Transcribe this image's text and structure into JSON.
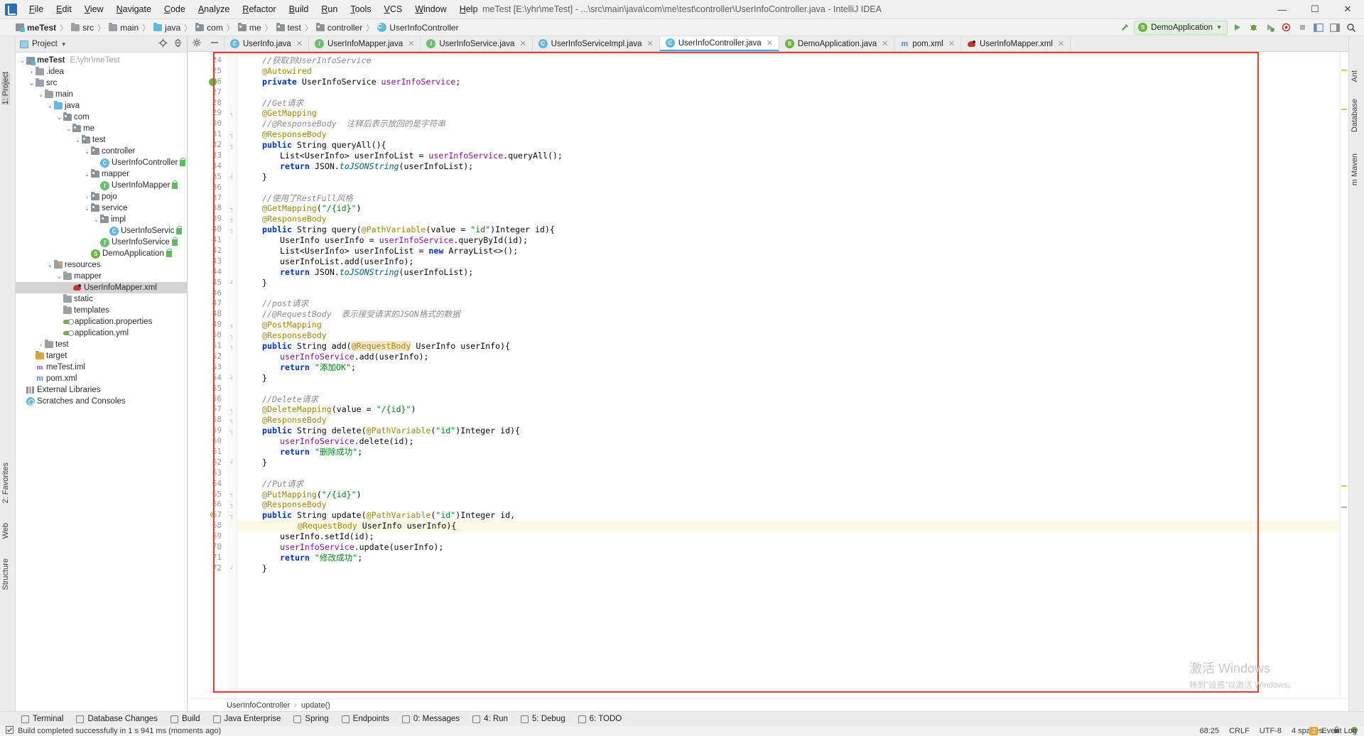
{
  "window": {
    "title": "meTest [E:\\yhr\\meTest] - ...\\src\\main\\java\\com\\me\\test\\controller\\UserInfoController.java - IntelliJ IDEA",
    "minimize": "—",
    "maximize": "☐",
    "close": "✕"
  },
  "menu": [
    "File",
    "Edit",
    "View",
    "Navigate",
    "Code",
    "Analyze",
    "Refactor",
    "Build",
    "Run",
    "Tools",
    "VCS",
    "Window",
    "Help"
  ],
  "navbar": {
    "crumbs": [
      "meTest",
      "src",
      "main",
      "java",
      "com",
      "me",
      "test",
      "controller",
      "UserInfoController"
    ],
    "run_config": "DemoApplication",
    "icons": [
      "hammer-build-icon",
      "run-icon",
      "debug-icon",
      "run-coverage-icon",
      "profiler-icon",
      "stop-icon",
      "search-everywhere-icon"
    ]
  },
  "project_panel": {
    "title": "Project",
    "tree": [
      {
        "depth": 0,
        "arrow": "⌄",
        "icon": "project",
        "label": "meTest",
        "path": "E:\\yhr\\meTest",
        "bold": true
      },
      {
        "depth": 1,
        "arrow": "›",
        "icon": "folder",
        "label": ".idea"
      },
      {
        "depth": 1,
        "arrow": "⌄",
        "icon": "folder",
        "label": "src"
      },
      {
        "depth": 2,
        "arrow": "⌄",
        "icon": "folder",
        "label": "main"
      },
      {
        "depth": 3,
        "arrow": "⌄",
        "icon": "folder-blue",
        "label": "java"
      },
      {
        "depth": 4,
        "arrow": "⌄",
        "icon": "package",
        "label": "com"
      },
      {
        "depth": 5,
        "arrow": "⌄",
        "icon": "package",
        "label": "me"
      },
      {
        "depth": 6,
        "arrow": "⌄",
        "icon": "package",
        "label": "test"
      },
      {
        "depth": 7,
        "arrow": "⌄",
        "icon": "package",
        "label": "controller"
      },
      {
        "depth": 8,
        "arrow": "",
        "icon": "class",
        "label": "UserInfoController",
        "lock": true
      },
      {
        "depth": 7,
        "arrow": "⌄",
        "icon": "package",
        "label": "mapper"
      },
      {
        "depth": 8,
        "arrow": "",
        "icon": "interface",
        "label": "UserInfoMapper",
        "lock": true
      },
      {
        "depth": 7,
        "arrow": "›",
        "icon": "package",
        "label": "pojo"
      },
      {
        "depth": 7,
        "arrow": "⌄",
        "icon": "package",
        "label": "service"
      },
      {
        "depth": 8,
        "arrow": "⌄",
        "icon": "package",
        "label": "impl"
      },
      {
        "depth": 9,
        "arrow": "",
        "icon": "class",
        "label": "UserInfoServic",
        "lock": true
      },
      {
        "depth": 8,
        "arrow": "",
        "icon": "interface",
        "label": "UserInfoService",
        "lock": true
      },
      {
        "depth": 7,
        "arrow": "",
        "icon": "spring",
        "label": "DemoApplication",
        "lock": true
      },
      {
        "depth": 3,
        "arrow": "⌄",
        "icon": "resources",
        "label": "resources"
      },
      {
        "depth": 4,
        "arrow": "⌄",
        "icon": "folder",
        "label": "mapper"
      },
      {
        "depth": 5,
        "arrow": "",
        "icon": "xml",
        "label": "UserInfoMapper.xml",
        "selected": true
      },
      {
        "depth": 4,
        "arrow": "",
        "icon": "folder",
        "label": "static"
      },
      {
        "depth": 4,
        "arrow": "",
        "icon": "folder",
        "label": "templates"
      },
      {
        "depth": 4,
        "arrow": "",
        "icon": "properties",
        "label": "application.properties"
      },
      {
        "depth": 4,
        "arrow": "",
        "icon": "properties",
        "label": "application.yml"
      },
      {
        "depth": 2,
        "arrow": "›",
        "icon": "folder",
        "label": "test"
      },
      {
        "depth": 1,
        "arrow": "",
        "icon": "folder-target",
        "label": "target"
      },
      {
        "depth": 1,
        "arrow": "",
        "icon": "iml",
        "label": "meTest.iml"
      },
      {
        "depth": 1,
        "arrow": "",
        "icon": "maven",
        "label": "pom.xml"
      },
      {
        "depth": 0,
        "arrow": "",
        "icon": "library",
        "label": "External Libraries"
      },
      {
        "depth": 0,
        "arrow": "",
        "icon": "scratch",
        "label": "Scratches and Consoles"
      }
    ]
  },
  "left_strip": [
    "1: Project",
    "2: Favorites",
    "Web",
    "Structure"
  ],
  "right_strip": [
    "Ant",
    "Database",
    "m Maven"
  ],
  "editor_tabs": [
    {
      "label": "UserInfo.java",
      "icon": "class",
      "active": false
    },
    {
      "label": "UserInfoMapper.java",
      "icon": "interface",
      "active": false
    },
    {
      "label": "UserInfoService.java",
      "icon": "interface",
      "active": false
    },
    {
      "label": "UserInfoServiceImpl.java",
      "icon": "class",
      "active": false
    },
    {
      "label": "UserInfoController.java",
      "icon": "class",
      "active": true
    },
    {
      "label": "DemoApplication.java",
      "icon": "spring",
      "active": false
    },
    {
      "label": "pom.xml",
      "icon": "maven",
      "active": false
    },
    {
      "label": "UserInfoMapper.xml",
      "icon": "xml",
      "active": false
    }
  ],
  "code": {
    "first_line": 24,
    "lines": [
      {
        "n": 24,
        "indent": 1,
        "spans": [
          {
            "t": "//获取到UserInfoService",
            "c": "cm"
          }
        ]
      },
      {
        "n": 25,
        "indent": 1,
        "spans": [
          {
            "t": "@Autowired",
            "c": "ann"
          }
        ]
      },
      {
        "n": 26,
        "indent": 1,
        "gutter_icon": "spring-bean-icon",
        "spans": [
          {
            "t": "private ",
            "c": "kw"
          },
          {
            "t": "UserInfoService ",
            "c": "pl"
          },
          {
            "t": "userInfoService",
            "c": "fld"
          },
          {
            "t": ";",
            "c": "pl"
          }
        ]
      },
      {
        "n": 27,
        "indent": 0,
        "spans": []
      },
      {
        "n": 28,
        "indent": 1,
        "spans": [
          {
            "t": "//Get请求",
            "c": "cm"
          }
        ]
      },
      {
        "n": 29,
        "indent": 1,
        "fold": "┐",
        "spans": [
          {
            "t": "@GetMapping",
            "c": "ann"
          }
        ]
      },
      {
        "n": 30,
        "indent": 1,
        "spans": [
          {
            "t": "//@ResponseBody  注释后表示放回的是字符串",
            "c": "cm"
          }
        ]
      },
      {
        "n": 31,
        "indent": 1,
        "fold": "┐",
        "spans": [
          {
            "t": "@ResponseBody",
            "c": "ann"
          }
        ]
      },
      {
        "n": 32,
        "indent": 1,
        "fold": "┐",
        "spans": [
          {
            "t": "public ",
            "c": "kw"
          },
          {
            "t": "String ",
            "c": "pl"
          },
          {
            "t": "queryAll",
            "c": "pl"
          },
          {
            "t": "(){",
            "c": "pl"
          }
        ]
      },
      {
        "n": 33,
        "indent": 2,
        "spans": [
          {
            "t": "List<UserInfo> userInfoList = ",
            "c": "pl"
          },
          {
            "t": "userInfoService",
            "c": "fld"
          },
          {
            "t": ".",
            "c": "pl"
          },
          {
            "t": "queryAll",
            "c": "pl"
          },
          {
            "t": "();",
            "c": "pl"
          }
        ]
      },
      {
        "n": 34,
        "indent": 2,
        "spans": [
          {
            "t": "return ",
            "c": "kw"
          },
          {
            "t": "JSON.",
            "c": "pl"
          },
          {
            "t": "toJSONString",
            "c": "mth"
          },
          {
            "t": "(userInfoList);",
            "c": "pl"
          }
        ]
      },
      {
        "n": 35,
        "indent": 1,
        "fold": "┘",
        "spans": [
          {
            "t": "}",
            "c": "pl"
          }
        ]
      },
      {
        "n": 36,
        "indent": 0,
        "spans": []
      },
      {
        "n": 37,
        "indent": 1,
        "spans": [
          {
            "t": "//使用了RestFull风格",
            "c": "cm"
          }
        ]
      },
      {
        "n": 38,
        "indent": 1,
        "fold": "┐",
        "spans": [
          {
            "t": "@GetMapping",
            "c": "ann"
          },
          {
            "t": "(",
            "c": "pl"
          },
          {
            "t": "\"/{id}\"",
            "c": "str"
          },
          {
            "t": ")",
            "c": "pl"
          }
        ]
      },
      {
        "n": 39,
        "indent": 1,
        "fold": "┐",
        "spans": [
          {
            "t": "@ResponseBody",
            "c": "ann"
          }
        ]
      },
      {
        "n": 40,
        "indent": 1,
        "fold": "┐",
        "spans": [
          {
            "t": "public ",
            "c": "kw"
          },
          {
            "t": "String query(",
            "c": "pl"
          },
          {
            "t": "@PathVariable",
            "c": "ann"
          },
          {
            "t": "(value = ",
            "c": "pl"
          },
          {
            "t": "\"id\"",
            "c": "str"
          },
          {
            "t": ")Integer id){",
            "c": "pl"
          }
        ]
      },
      {
        "n": 41,
        "indent": 2,
        "spans": [
          {
            "t": "UserInfo userInfo = ",
            "c": "pl"
          },
          {
            "t": "userInfoService",
            "c": "fld"
          },
          {
            "t": ".",
            "c": "pl"
          },
          {
            "t": "queryById",
            "c": "pl"
          },
          {
            "t": "(id);",
            "c": "pl"
          }
        ]
      },
      {
        "n": 42,
        "indent": 2,
        "spans": [
          {
            "t": "List<UserInfo> userInfoList = ",
            "c": "pl"
          },
          {
            "t": "new ",
            "c": "kw"
          },
          {
            "t": "ArrayList<>();",
            "c": "pl"
          }
        ]
      },
      {
        "n": 43,
        "indent": 2,
        "spans": [
          {
            "t": "userInfoList.add(userInfo);",
            "c": "pl"
          }
        ]
      },
      {
        "n": 44,
        "indent": 2,
        "spans": [
          {
            "t": "return ",
            "c": "kw"
          },
          {
            "t": "JSON.",
            "c": "pl"
          },
          {
            "t": "toJSONString",
            "c": "mth"
          },
          {
            "t": "(userInfoList);",
            "c": "pl"
          }
        ]
      },
      {
        "n": 45,
        "indent": 1,
        "fold": "┘",
        "spans": [
          {
            "t": "}",
            "c": "pl"
          }
        ]
      },
      {
        "n": 46,
        "indent": 0,
        "spans": []
      },
      {
        "n": 47,
        "indent": 1,
        "spans": [
          {
            "t": "//post请求",
            "c": "cm"
          }
        ]
      },
      {
        "n": 48,
        "indent": 1,
        "spans": [
          {
            "t": "//@RequestBody  表示接受请求的JSON格式的数据",
            "c": "cm"
          }
        ]
      },
      {
        "n": 49,
        "indent": 1,
        "fold": "┐",
        "spans": [
          {
            "t": "@PostMapping",
            "c": "ann"
          }
        ]
      },
      {
        "n": 50,
        "indent": 1,
        "fold": "┐",
        "spans": [
          {
            "t": "@ResponseBody",
            "c": "ann"
          }
        ]
      },
      {
        "n": 51,
        "indent": 1,
        "fold": "┐",
        "spans": [
          {
            "t": "public ",
            "c": "kw"
          },
          {
            "t": "String add(",
            "c": "pl"
          },
          {
            "t": "@RequestBody",
            "c": "ann",
            "hl": true
          },
          {
            "t": " UserInfo userInfo){",
            "c": "pl"
          }
        ]
      },
      {
        "n": 52,
        "indent": 2,
        "spans": [
          {
            "t": "userInfoService",
            "c": "fld"
          },
          {
            "t": ".add(userInfo);",
            "c": "pl"
          }
        ]
      },
      {
        "n": 53,
        "indent": 2,
        "spans": [
          {
            "t": "return ",
            "c": "kw"
          },
          {
            "t": "\"添加OK\"",
            "c": "str"
          },
          {
            "t": ";",
            "c": "pl"
          }
        ]
      },
      {
        "n": 54,
        "indent": 1,
        "fold": "┘",
        "spans": [
          {
            "t": "}",
            "c": "pl"
          }
        ]
      },
      {
        "n": 55,
        "indent": 0,
        "spans": []
      },
      {
        "n": 56,
        "indent": 1,
        "spans": [
          {
            "t": "//Delete请求",
            "c": "cm"
          }
        ]
      },
      {
        "n": 57,
        "indent": 1,
        "fold": "┐",
        "spans": [
          {
            "t": "@DeleteMapping",
            "c": "ann"
          },
          {
            "t": "(value = ",
            "c": "pl"
          },
          {
            "t": "\"/{id}\"",
            "c": "str"
          },
          {
            "t": ")",
            "c": "pl"
          }
        ]
      },
      {
        "n": 58,
        "indent": 1,
        "fold": "┐",
        "spans": [
          {
            "t": "@ResponseBody",
            "c": "ann"
          }
        ]
      },
      {
        "n": 59,
        "indent": 1,
        "fold": "┐",
        "spans": [
          {
            "t": "public ",
            "c": "kw"
          },
          {
            "t": "String delete(",
            "c": "pl"
          },
          {
            "t": "@PathVariable",
            "c": "ann"
          },
          {
            "t": "(",
            "c": "pl"
          },
          {
            "t": "\"id\"",
            "c": "str"
          },
          {
            "t": ")Integer id){",
            "c": "pl"
          }
        ]
      },
      {
        "n": 60,
        "indent": 2,
        "spans": [
          {
            "t": "userInfoService",
            "c": "fld"
          },
          {
            "t": ".delete(id);",
            "c": "pl"
          }
        ]
      },
      {
        "n": 61,
        "indent": 2,
        "spans": [
          {
            "t": "return ",
            "c": "kw"
          },
          {
            "t": "\"删除成功\"",
            "c": "str"
          },
          {
            "t": ";",
            "c": "pl"
          }
        ]
      },
      {
        "n": 62,
        "indent": 1,
        "fold": "┘",
        "spans": [
          {
            "t": "}",
            "c": "pl"
          }
        ]
      },
      {
        "n": 63,
        "indent": 0,
        "spans": []
      },
      {
        "n": 64,
        "indent": 1,
        "spans": [
          {
            "t": "//Put请求",
            "c": "cm"
          }
        ]
      },
      {
        "n": 65,
        "indent": 1,
        "fold": "┐",
        "spans": [
          {
            "t": "@PutMapping",
            "c": "ann"
          },
          {
            "t": "(",
            "c": "pl"
          },
          {
            "t": "\"/{id}\"",
            "c": "str"
          },
          {
            "t": ")",
            "c": "pl"
          }
        ]
      },
      {
        "n": 66,
        "indent": 1,
        "fold": "┐",
        "spans": [
          {
            "t": "@ResponseBody",
            "c": "ann"
          }
        ]
      },
      {
        "n": 67,
        "indent": 1,
        "fold": "┐",
        "marker": "@",
        "spans": [
          {
            "t": "public ",
            "c": "kw"
          },
          {
            "t": "String update(",
            "c": "pl"
          },
          {
            "t": "@PathVariable",
            "c": "ann"
          },
          {
            "t": "(",
            "c": "pl"
          },
          {
            "t": "\"id\"",
            "c": "str"
          },
          {
            "t": ")Integer id,",
            "c": "pl"
          }
        ]
      },
      {
        "n": 68,
        "indent": 3,
        "hl": true,
        "spans": [
          {
            "t": "@RequestBody",
            "c": "ann"
          },
          {
            "t": " UserInfo userInfo){",
            "c": "pl"
          }
        ]
      },
      {
        "n": 69,
        "indent": 2,
        "spans": [
          {
            "t": "userInfo.setId(id);",
            "c": "pl"
          }
        ]
      },
      {
        "n": 70,
        "indent": 2,
        "spans": [
          {
            "t": "userInfoService",
            "c": "fld"
          },
          {
            "t": ".update(userInfo);",
            "c": "pl"
          }
        ]
      },
      {
        "n": 71,
        "indent": 2,
        "spans": [
          {
            "t": "return ",
            "c": "kw"
          },
          {
            "t": "\"修改成功\"",
            "c": "str"
          },
          {
            "t": ";",
            "c": "pl"
          }
        ]
      },
      {
        "n": 72,
        "indent": 1,
        "fold": "┘",
        "spans": [
          {
            "t": "}",
            "c": "pl"
          }
        ]
      }
    ]
  },
  "editor_breadcrumb": [
    "UserInfoController",
    "update()"
  ],
  "bottom_bar": [
    {
      "label": "Terminal",
      "icon": "terminal-icon"
    },
    {
      "label": "Database Changes",
      "icon": "database-icon"
    },
    {
      "label": "Build",
      "icon": "build-icon"
    },
    {
      "label": "Java Enterprise",
      "icon": "java-ee-icon"
    },
    {
      "label": "Spring",
      "icon": "spring-icon"
    },
    {
      "label": "Endpoints",
      "icon": "endpoints-icon"
    },
    {
      "label": "0: Messages",
      "icon": "messages-icon"
    },
    {
      "label": "4: Run",
      "icon": "run-icon"
    },
    {
      "label": "5: Debug",
      "icon": "debug-icon"
    },
    {
      "label": "6: TODO",
      "icon": "todo-icon"
    }
  ],
  "status": {
    "message": "Build completed successfully in 1 s 941 ms (moments ago)",
    "caret": "68:25",
    "line_sep": "CRLF",
    "encoding": "UTF-8",
    "indent": "4 spaces",
    "event_log": "Event Log",
    "event_count": "2"
  },
  "watermark": {
    "line1": "激活 Windows",
    "line2": "转到\"设置\"以激活 Windows。"
  },
  "colors": {
    "accent": "#3f9fe0",
    "frame_red": "#e03c31",
    "keyword": "#0033b3",
    "string": "#067d17",
    "annotation": "#9e880d",
    "comment": "#8c8c8c",
    "field": "#871094"
  }
}
